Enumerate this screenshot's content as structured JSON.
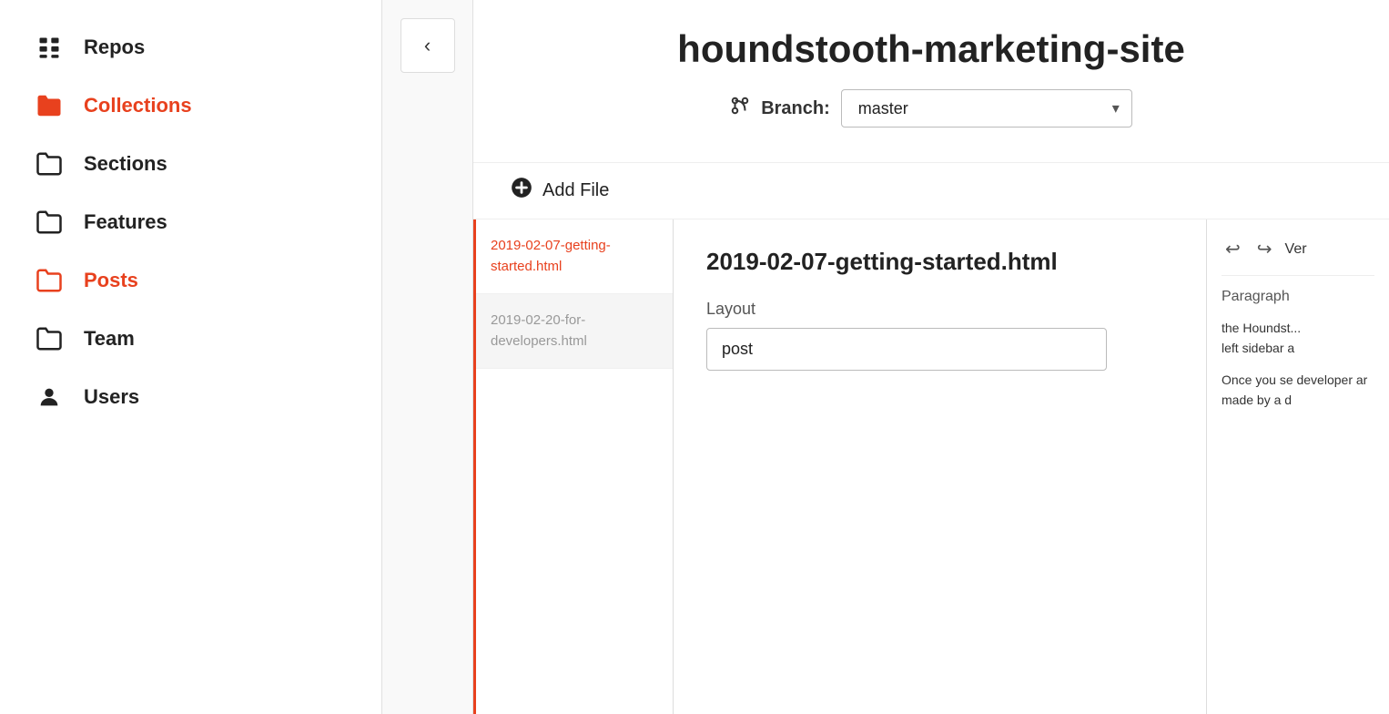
{
  "sidebar": {
    "items": [
      {
        "id": "repos",
        "label": "Repos",
        "icon": "grid",
        "active": false
      },
      {
        "id": "collections",
        "label": "Collections",
        "icon": "folder-filled",
        "active": false,
        "accent": true
      },
      {
        "id": "sections",
        "label": "Sections",
        "icon": "folder",
        "active": false
      },
      {
        "id": "features",
        "label": "Features",
        "icon": "folder",
        "active": false
      },
      {
        "id": "posts",
        "label": "Posts",
        "icon": "folder",
        "active": true,
        "accent": true
      },
      {
        "id": "team",
        "label": "Team",
        "icon": "folder",
        "active": false
      },
      {
        "id": "users",
        "label": "Users",
        "icon": "user",
        "active": false
      }
    ]
  },
  "back_button": "‹",
  "main": {
    "title": "houndstooth-marketing-site",
    "branch_label": "Branch:",
    "branch_value": "master",
    "add_file_label": "Add File"
  },
  "files": [
    {
      "id": "file1",
      "name": "2019-02-07-getting-started.html",
      "active": false,
      "selected": true
    },
    {
      "id": "file2",
      "name": "2019-02-20-for-developers.html",
      "active": true
    }
  ],
  "editor": {
    "filename": "2019-02-07-getting-started.html",
    "layout_label": "Layout",
    "layout_value": "post"
  },
  "preview": {
    "undo_icon": "↩",
    "redo_icon": "↪",
    "ver_label": "Ver",
    "format_label": "Paragraph",
    "text_line1": "the Houndst...",
    "text_line2": "left sidebar a",
    "text_body": "Once you se developer ar made by a d"
  }
}
